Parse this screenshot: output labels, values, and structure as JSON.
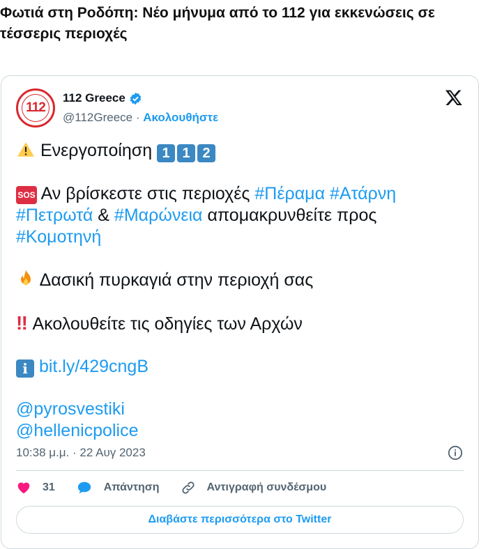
{
  "article": {
    "title": "Φωτιά στη Ροδόπη: Νέο μήνυμα από το 112 για εκκενώσεις σε τέσσερις περιοχές"
  },
  "tweet": {
    "author": {
      "display_name": "112 Greece",
      "handle": "@112Greece",
      "separator": " · ",
      "follow_label": "Ακολουθήστε",
      "avatar_text": "112"
    },
    "line1": {
      "text": "Ενεργοποίηση",
      "keycaps": [
        "1",
        "1",
        "2"
      ]
    },
    "line2": {
      "sos": "SOS",
      "text_a": " Αν βρίσκεστε στις περιοχές ",
      "tag1": "#Πέραμα",
      "space": " ",
      "tag2": "#Ατάρνη",
      "tag3": "#Πετρωτά",
      "amp": " & ",
      "tag4": "#Μαρώνεια",
      "text_b": " απομακρυνθείτε προς ",
      "tag5": "#Κομοτηνή"
    },
    "line3": {
      "text": " Δασική πυρκαγιά στην περιοχή σας"
    },
    "line4": {
      "bang": "‼",
      "text": " Ακολουθείτε τις οδηγίες των Αρχών"
    },
    "line5": {
      "info": "i",
      "link": "bit.ly/429cngB"
    },
    "mentions": [
      "@pyrosvestiki",
      "@hellenicpolice"
    ],
    "timestamp": "10:38 μ.μ. · 22 Αυγ 2023",
    "likes": "31",
    "reply_label": "Απάντηση",
    "copy_link_label": "Αντιγραφή συνδέσμου",
    "read_more_label": "Διαβάστε περισσότερα στο Twitter"
  },
  "colors": {
    "accent": "#1d9bf0",
    "like": "#f91880",
    "brand_red": "#d9272e"
  },
  "icons": [
    "verified-badge-icon",
    "x-logo-icon",
    "warning-icon",
    "fire-icon",
    "info-circle-icon",
    "heart-icon",
    "reply-bubble-icon",
    "link-icon"
  ]
}
